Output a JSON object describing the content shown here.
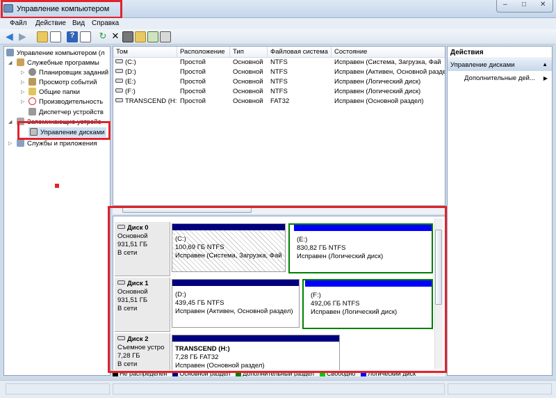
{
  "window": {
    "title": "Управление компьютером",
    "controls": [
      "–",
      "□",
      "✕"
    ]
  },
  "menu": [
    "Файл",
    "Действие",
    "Вид",
    "Справка"
  ],
  "toolbar": {
    "icons": [
      "back-arrow-icon",
      "forward-arrow-icon",
      "up-folder-icon",
      "show-tree-icon",
      "help-icon",
      "properties-icon",
      "refresh-icon",
      "delete-icon",
      "export-icon",
      "open-folder-icon",
      "search-icon",
      "disk-icon"
    ]
  },
  "tree": [
    {
      "label": "Управление компьютером (л",
      "level": 0,
      "expander": ""
    },
    {
      "label": "Служебные программы",
      "level": 1,
      "expander": "◢"
    },
    {
      "label": "Планировщик заданий",
      "level": 2,
      "expander": "▷"
    },
    {
      "label": "Просмотр событий",
      "level": 2,
      "expander": "▷"
    },
    {
      "label": "Общие папки",
      "level": 2,
      "expander": "▷"
    },
    {
      "label": "Производительность",
      "level": 2,
      "expander": "▷"
    },
    {
      "label": "Диспетчер устройств",
      "level": 2,
      "expander": ""
    },
    {
      "label": "Запоминающие устройс",
      "level": 1,
      "expander": "◢"
    },
    {
      "label": "Управление дисками",
      "level": 2,
      "expander": ""
    },
    {
      "label": "Службы и приложения",
      "level": 1,
      "expander": "▷"
    }
  ],
  "volumes": {
    "columns": [
      "Том",
      "Расположение",
      "Тип",
      "Файловая система",
      "Состояние"
    ],
    "rows": [
      [
        "(C:)",
        "Простой",
        "Основной",
        "NTFS",
        "Исправен (Система, Загрузка, Фай"
      ],
      [
        "(D:)",
        "Простой",
        "Основной",
        "NTFS",
        "Исправен (Активен, Основной разде"
      ],
      [
        "(E:)",
        "Простой",
        "Основной",
        "NTFS",
        "Исправен (Логический диск)"
      ],
      [
        "(F:)",
        "Простой",
        "Основной",
        "NTFS",
        "Исправен (Логический диск)"
      ],
      [
        "TRANSCEND (H:)",
        "Простой",
        "Основной",
        "FAT32",
        "Исправен (Основной раздел)"
      ]
    ]
  },
  "disks": [
    {
      "name": "Диск 0",
      "type": "Основной",
      "size": "931,51 ГБ",
      "status": "В сети",
      "partitions": [
        {
          "title": "(C:)",
          "size": "100,69 ГБ NTFS",
          "status": "Исправен (Система, Загрузка, Фай"
        },
        {
          "title": "(E:)",
          "size": "830,82 ГБ NTFS",
          "status": "Исправен (Логический диск)"
        }
      ]
    },
    {
      "name": "Диск 1",
      "type": "Основной",
      "size": "931,51 ГБ",
      "status": "В сети",
      "partitions": [
        {
          "title": "(D:)",
          "size": "439,45 ГБ NTFS",
          "status": "Исправен (Активен, Основной раздел)"
        },
        {
          "title": "(F:)",
          "size": "492,06 ГБ NTFS",
          "status": "Исправен (Логический диск)"
        }
      ]
    },
    {
      "name": "Диск 2",
      "type": "Съемное устро",
      "size": "7,28 ГБ",
      "status": "В сети",
      "partitions": [
        {
          "title": "TRANSCEND  (H:)",
          "size": "7,28 ГБ FAT32",
          "status": "Исправен (Основной раздел)"
        }
      ]
    }
  ],
  "legend": [
    {
      "label": "Не распределен",
      "color": "#000000"
    },
    {
      "label": "Основной раздел",
      "color": "#00007f"
    },
    {
      "label": "Дополнительный раздел",
      "color": "#007f00"
    },
    {
      "label": "Свободно",
      "color": "#00cc00"
    },
    {
      "label": "Логический диск",
      "color": "#0000ff"
    }
  ],
  "actions": {
    "header": "Действия",
    "selected": "Управление дисками",
    "more": "Дополнительные дей..."
  },
  "colors": {
    "highlight": "#e0242c",
    "primary": "#00007f",
    "logical": "#0000ff",
    "extended": "#007f00"
  }
}
